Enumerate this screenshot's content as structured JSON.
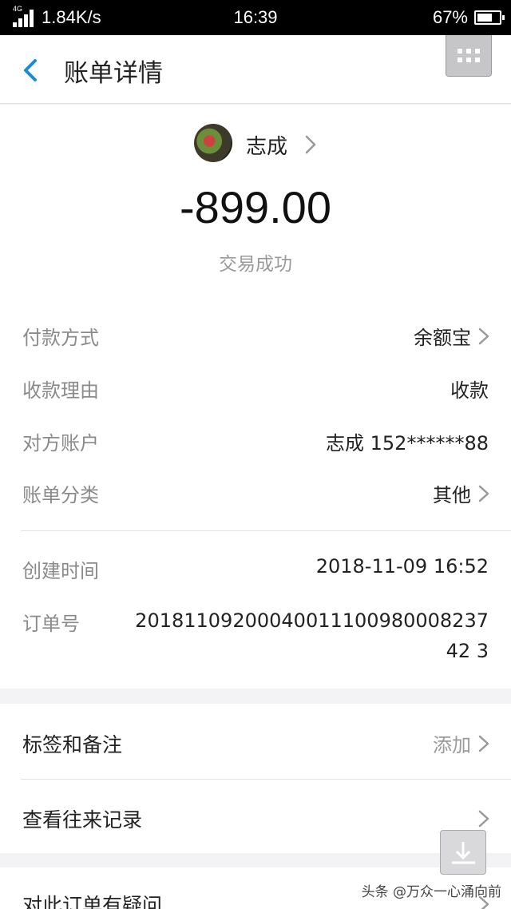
{
  "status_bar": {
    "network": "4G",
    "speed": "1.84K/s",
    "time": "16:39",
    "battery": "67%"
  },
  "header": {
    "title": "账单详情"
  },
  "payee": {
    "name": "志成"
  },
  "amount": "-899.00",
  "status_text": "交易成功",
  "details": [
    {
      "label": "付款方式",
      "value": "余额宝"
    },
    {
      "label": "收款理由",
      "value": "收款"
    },
    {
      "label": "对方账户",
      "value": "志成 152******88"
    },
    {
      "label": "账单分类",
      "value": "其他"
    },
    {
      "label": "创建时间",
      "value": "2018-11-09 16:52"
    },
    {
      "label": "订单号",
      "value": "2018110920004001110098000823742 3"
    }
  ],
  "actions": {
    "tags_notes": {
      "label": "标签和备注",
      "hint": "添加"
    },
    "history": {
      "label": "查看往来记录"
    },
    "question": {
      "label": "对此订单有疑问"
    }
  },
  "watermark": "头条 @万众一心涌向前",
  "colors": {
    "accent": "#1a8bd6",
    "background": "#f3f3f5",
    "label_gray": "#8a8a8a"
  }
}
